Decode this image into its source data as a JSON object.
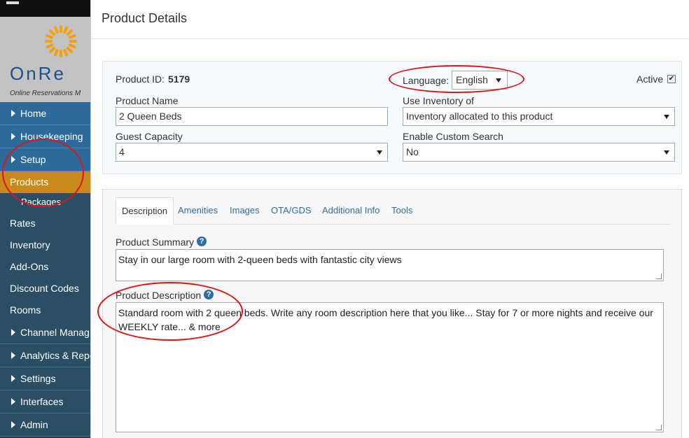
{
  "brand": {
    "name": "OnRe",
    "tagline": "Online Reservations M"
  },
  "sidebar": {
    "items": [
      {
        "label": "Home",
        "type": "main"
      },
      {
        "label": "Housekeeping",
        "type": "main"
      },
      {
        "label": "Setup",
        "type": "main"
      },
      {
        "label": "Products",
        "type": "active"
      },
      {
        "label": "Packages",
        "type": "sub"
      },
      {
        "label": "Rates",
        "type": "sub"
      },
      {
        "label": "Inventory",
        "type": "sub"
      },
      {
        "label": "Add-Ons",
        "type": "sub"
      },
      {
        "label": "Discount Codes",
        "type": "sub"
      },
      {
        "label": "Rooms",
        "type": "sub"
      },
      {
        "label": "Channel Manag",
        "type": "main"
      },
      {
        "label": "Analytics & Repo",
        "type": "main"
      },
      {
        "label": "Settings",
        "type": "main"
      },
      {
        "label": "Interfaces",
        "type": "main"
      },
      {
        "label": "Admin",
        "type": "main"
      }
    ]
  },
  "modal": {
    "title": "Product Details",
    "product_id_label": "Product ID:",
    "product_id": "5179",
    "language_label": "Language:",
    "language_value": "English",
    "active_label": "Active",
    "active_checked": true,
    "product_name_label": "Product Name",
    "product_name_value": "2 Queen Beds",
    "inventory_label": "Use Inventory of",
    "inventory_value": "Inventory allocated to this product",
    "guest_capacity_label": "Guest Capacity",
    "guest_capacity_value": "4",
    "custom_search_label": "Enable Custom Search",
    "custom_search_value": "No"
  },
  "tabs": [
    "Description",
    "Amenities",
    "Images",
    "OTA/GDS",
    "Additional Info",
    "Tools"
  ],
  "description": {
    "summary_label": "Product Summary",
    "summary_value": "Stay in our large room with 2-queen beds with fantastic city views",
    "desc_label": "Product Description",
    "desc_value": "Standard room with 2 queen beds. Write any room description here that you like... Stay for 7 or more nights and receive our WEEKLY rate... & more"
  },
  "colors": {
    "annotation": "#e01515",
    "nav_blue": "#2c6a9a",
    "nav_active": "#c98a1c",
    "link": "#2c6fa6"
  },
  "icons": {
    "help": "question-circle-icon",
    "caret": "caret-right-icon",
    "dropdown": "chevron-down-icon"
  }
}
